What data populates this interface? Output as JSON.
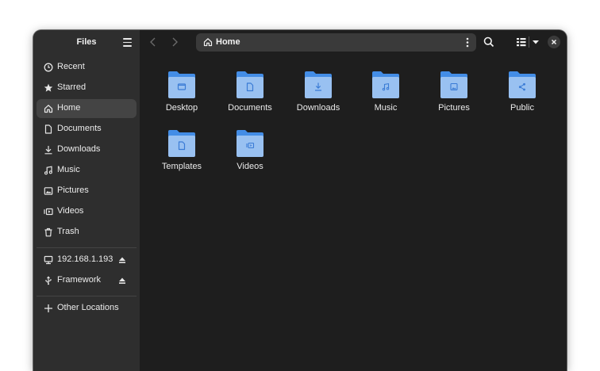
{
  "window": {
    "app_title": "Files"
  },
  "sidebar": {
    "items": [
      {
        "label": "Recent",
        "icon": "clock-icon"
      },
      {
        "label": "Starred",
        "icon": "star-icon"
      },
      {
        "label": "Home",
        "icon": "home-icon",
        "active": true
      },
      {
        "label": "Documents",
        "icon": "document-icon"
      },
      {
        "label": "Downloads",
        "icon": "download-icon"
      },
      {
        "label": "Music",
        "icon": "music-icon"
      },
      {
        "label": "Pictures",
        "icon": "picture-icon"
      },
      {
        "label": "Videos",
        "icon": "video-icon"
      },
      {
        "label": "Trash",
        "icon": "trash-icon"
      }
    ],
    "devices": [
      {
        "label": "192.168.1.193",
        "icon": "network-drive-icon",
        "eject": true
      },
      {
        "label": "Framework",
        "icon": "usb-icon",
        "eject": true
      }
    ],
    "other": {
      "label": "Other Locations",
      "icon": "plus-icon"
    }
  },
  "toolbar": {
    "path_label": "Home"
  },
  "folders": [
    {
      "label": "Desktop",
      "icon": "desktop-folder-icon"
    },
    {
      "label": "Documents",
      "icon": "documents-folder-icon"
    },
    {
      "label": "Downloads",
      "icon": "downloads-folder-icon"
    },
    {
      "label": "Music",
      "icon": "music-folder-icon"
    },
    {
      "label": "Pictures",
      "icon": "pictures-folder-icon"
    },
    {
      "label": "Public",
      "icon": "public-folder-icon"
    },
    {
      "label": "Templates",
      "icon": "templates-folder-icon"
    },
    {
      "label": "Videos",
      "icon": "videos-folder-icon"
    }
  ],
  "colors": {
    "folder_back": "#438de6",
    "folder_front": "#99c1f1",
    "folder_glyph": "#3a7bd5",
    "sidebar_bg": "#2e2e2e",
    "content_bg": "#1e1e1e"
  }
}
